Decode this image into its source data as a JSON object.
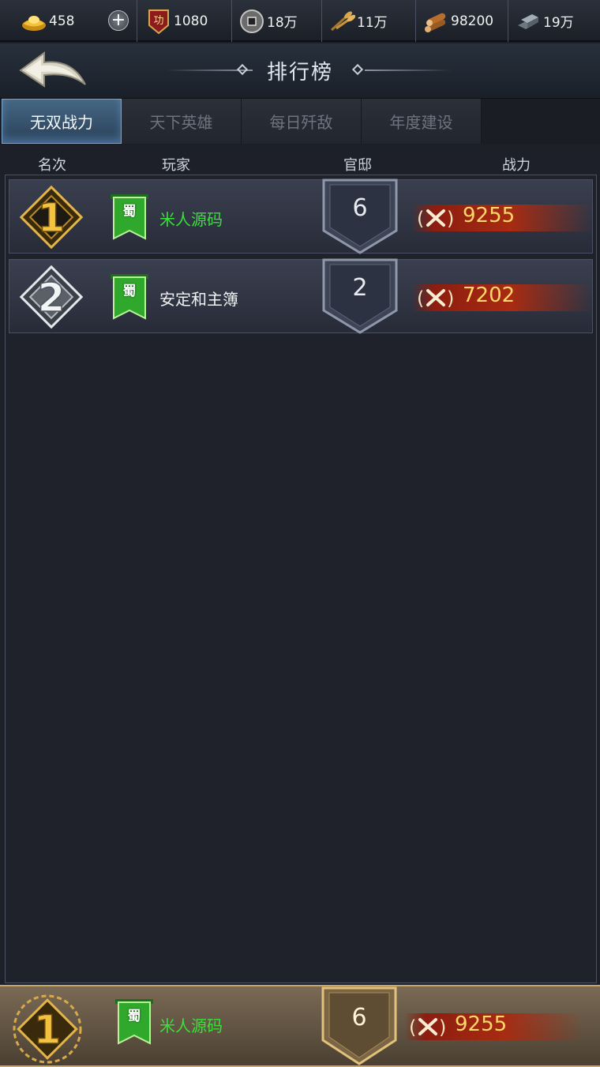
{
  "resources": [
    {
      "icon": "gold-ingot-icon",
      "value": "458"
    },
    {
      "icon": "merit-icon",
      "value": "1080"
    },
    {
      "icon": "copper-coin-icon",
      "value": "18万"
    },
    {
      "icon": "grain-icon",
      "value": "11万"
    },
    {
      "icon": "wood-icon",
      "value": "98200"
    },
    {
      "icon": "iron-icon",
      "value": "19万"
    }
  ],
  "merit_icon_char": "功",
  "title": "排行榜",
  "tabs": [
    "无双战力",
    "天下英雄",
    "每日歼敌",
    "年度建设"
  ],
  "active_tab": 0,
  "columns": {
    "rank": "名次",
    "player": "玩家",
    "mansion": "官邸",
    "power": "战力"
  },
  "rows": [
    {
      "rank": "1",
      "faction": "蜀",
      "name": "米人源码",
      "name_color": "#39e13a",
      "mansion": "6",
      "power": "9255"
    },
    {
      "rank": "2",
      "faction": "蜀",
      "name": "安定和主簿",
      "name_color": "#f2f2f2",
      "mansion": "2",
      "power": "7202"
    }
  ],
  "my_rank": {
    "rank": "1",
    "faction": "蜀",
    "name": "米人源码",
    "mansion": "6",
    "power": "9255"
  },
  "colors": {
    "accent_gold": "#ffd76a",
    "player_green": "#39e13a",
    "faction_green": "#2fa82b"
  }
}
